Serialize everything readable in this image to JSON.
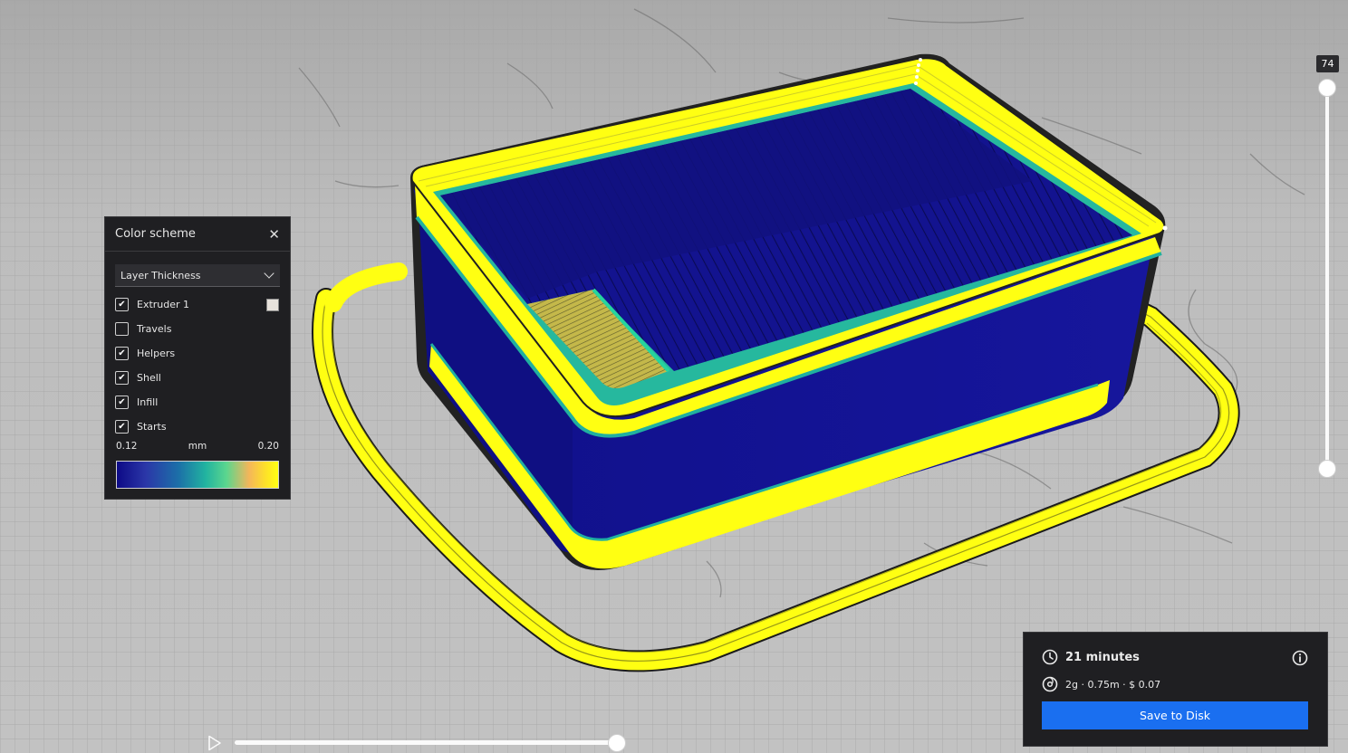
{
  "color_scheme": {
    "title": "Color scheme",
    "selected_scheme": "Layer Thickness",
    "options": [
      {
        "label": "Extruder 1",
        "checked": true,
        "swatch": "#e8e3dc"
      },
      {
        "label": "Travels",
        "checked": false
      },
      {
        "label": "Helpers",
        "checked": true
      },
      {
        "label": "Shell",
        "checked": true
      },
      {
        "label": "Infill",
        "checked": true
      },
      {
        "label": "Starts",
        "checked": true
      }
    ],
    "scale_min": "0.12",
    "scale_unit": "mm",
    "scale_max": "0.20",
    "gradient_colors": [
      "#0d0a86",
      "#1c6fa8",
      "#21b3a0",
      "#5bd68e",
      "#f4b65a",
      "#ffff12"
    ]
  },
  "layer_slider": {
    "current_layer": "74"
  },
  "playback": {
    "icon": "play-icon"
  },
  "print_info": {
    "time": "21 minutes",
    "material": "2g · 0.75m · $ 0.07",
    "save_label": "Save to Disk",
    "time_icon": "clock-icon",
    "material_icon": "spool-icon",
    "info_icon": "info-icon"
  },
  "colors": {
    "accent": "#1a6ff0",
    "model_body": "#0d0a86",
    "model_edge": "#ffff12",
    "panel_bg": "#1f1f22"
  }
}
